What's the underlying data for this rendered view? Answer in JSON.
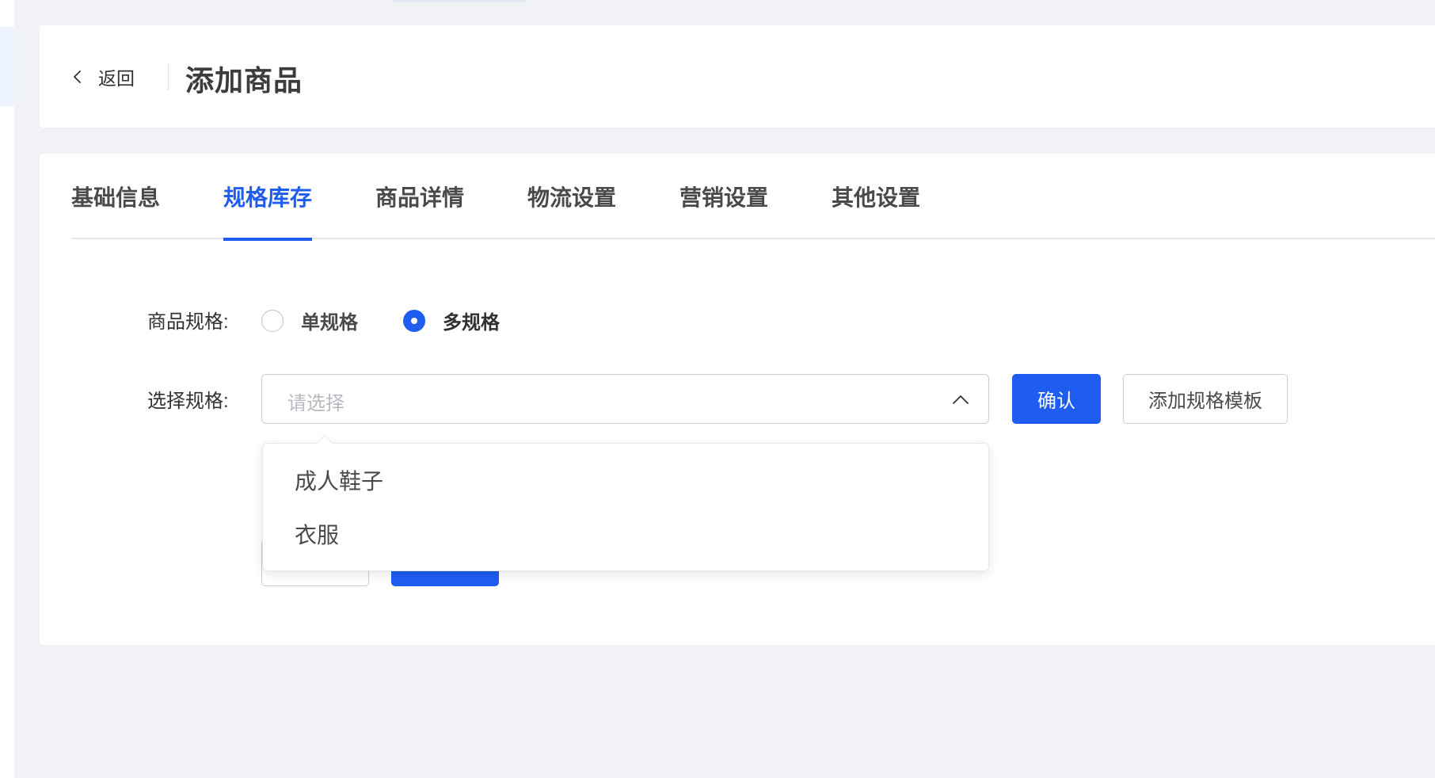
{
  "header": {
    "back_label": "返回",
    "title": "添加商品"
  },
  "tabs": [
    {
      "label": "基础信息",
      "active": false
    },
    {
      "label": "规格库存",
      "active": true
    },
    {
      "label": "商品详情",
      "active": false
    },
    {
      "label": "物流设置",
      "active": false
    },
    {
      "label": "营销设置",
      "active": false
    },
    {
      "label": "其他设置",
      "active": false
    }
  ],
  "form": {
    "spec_label": "商品规格:",
    "spec_options": [
      {
        "label": "单规格",
        "checked": false
      },
      {
        "label": "多规格",
        "checked": true
      }
    ],
    "select_spec_label": "选择规格:",
    "select_placeholder": "请选择",
    "confirm_label": "确认",
    "add_template_label": "添加规格模板"
  },
  "dropdown": {
    "options": [
      "成人鞋子",
      "衣服"
    ]
  },
  "colors": {
    "accent": "#1f5cf0",
    "background": "#f0f2f5"
  }
}
